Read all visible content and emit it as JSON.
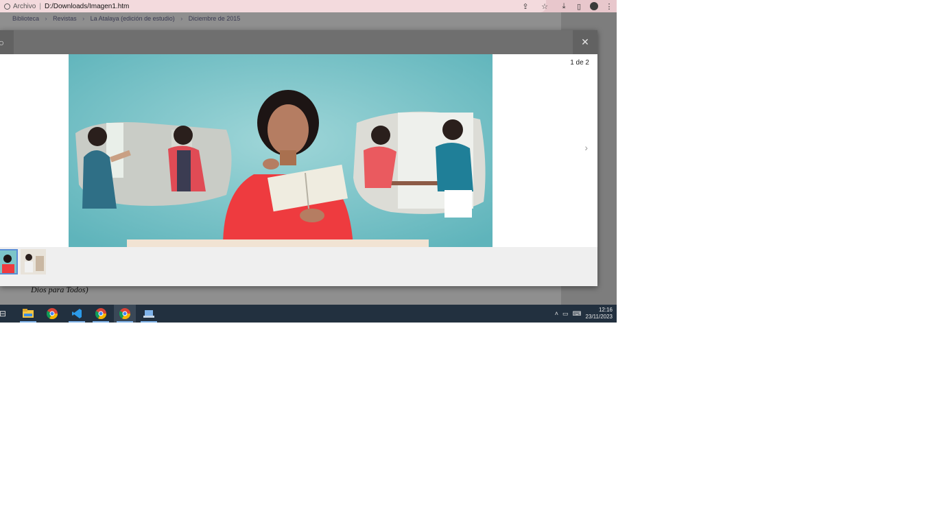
{
  "address_bar": {
    "scheme_label": "Archivo",
    "url": "D:/Downloads/Imagen1.htm",
    "icons": [
      "share-icon",
      "star-icon",
      "download-icon",
      "sidebar-icon",
      "profile-icon",
      "menu-icon"
    ]
  },
  "page": {
    "breadcrumb": [
      "Biblioteca",
      "Revistas",
      "La Atalaya (edición de estudio)",
      "Diciembre de 2015"
    ],
    "underlying_text": "Dios para Todos)"
  },
  "viewer": {
    "counter": "1 de 2",
    "next_icon": "chevron-right-icon",
    "close_icon": "close-icon",
    "thumbnails": [
      {
        "name": "thumbnail-1",
        "selected": true
      },
      {
        "name": "thumbnail-2",
        "selected": false
      }
    ]
  },
  "taskbar": {
    "apps": [
      "task-view",
      "file-explorer",
      "chrome",
      "vs-code",
      "chrome",
      "chrome-active",
      "app"
    ],
    "time": "12:16",
    "date": "23/11/2023"
  },
  "colors": {
    "backdrop": "#8a8a8a",
    "taskbar": "#22303f",
    "address_bar": "#e8c7cc"
  }
}
